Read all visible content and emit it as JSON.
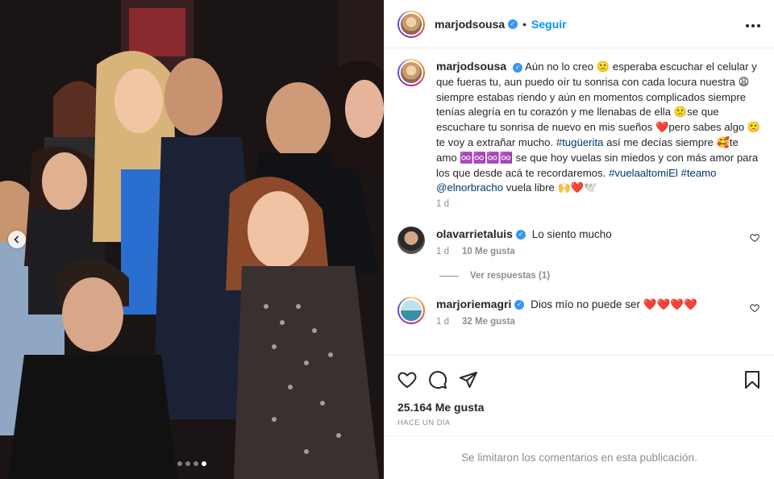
{
  "post": {
    "username": "marjodsousa",
    "separator": "•",
    "follow_label": "Seguir",
    "more_icon": "more-options-icon",
    "carousel": {
      "count": 4,
      "active": 3
    }
  },
  "caption": {
    "username": "marjodsousa",
    "parts": [
      "Aún no lo creo ",
      "🙁",
      " esperaba escuchar el celular y que fueras tu, aun puedo oír tu sonrisa con cada locura nuestra ",
      "😩",
      " siempre estabas riendo y aún en momentos complicados siempre tenías alegría en tu corazón y me llenabas de ella ",
      "🙁",
      "se que escuchare tu sonrisa de nuevo en mis sueños ",
      "❤️",
      "pero sabes algo ",
      "🙁",
      "te voy a extrañar mucho. ",
      "#tugüerita",
      " así me decías siempre ",
      "🥰",
      "te amo ",
      "♾️♾️♾️♾️",
      " se que hoy vuelas sin miedos y con más amor para los que desde acá te recordaremos. ",
      "#vuelaaltomiEl",
      " ",
      "#teamo",
      " ",
      "@elnorbracho",
      " vuela libre ",
      "🙌❤️🕊️"
    ],
    "time": "1 d"
  },
  "comments": [
    {
      "username": "olavarrietaluis",
      "text": "Lo siento mucho",
      "time": "1 d",
      "likes": "10 Me gusta",
      "replies": "Ver respuestas (1)"
    },
    {
      "username": "marjoriemagri",
      "text": "Dios mío no puede ser ",
      "emoji": "❤️❤️❤️❤️",
      "time": "1 d",
      "likes": "32 Me gusta"
    }
  ],
  "footer": {
    "likes": "25.164 Me gusta",
    "date": "HACE UN DÍA",
    "limited": "Se limitaron los comentarios en esta publicación."
  },
  "colors": {
    "accent": "#0095f6",
    "verified": "#3897f0",
    "heart": "#ed4956",
    "hashtag": "#00376b"
  }
}
